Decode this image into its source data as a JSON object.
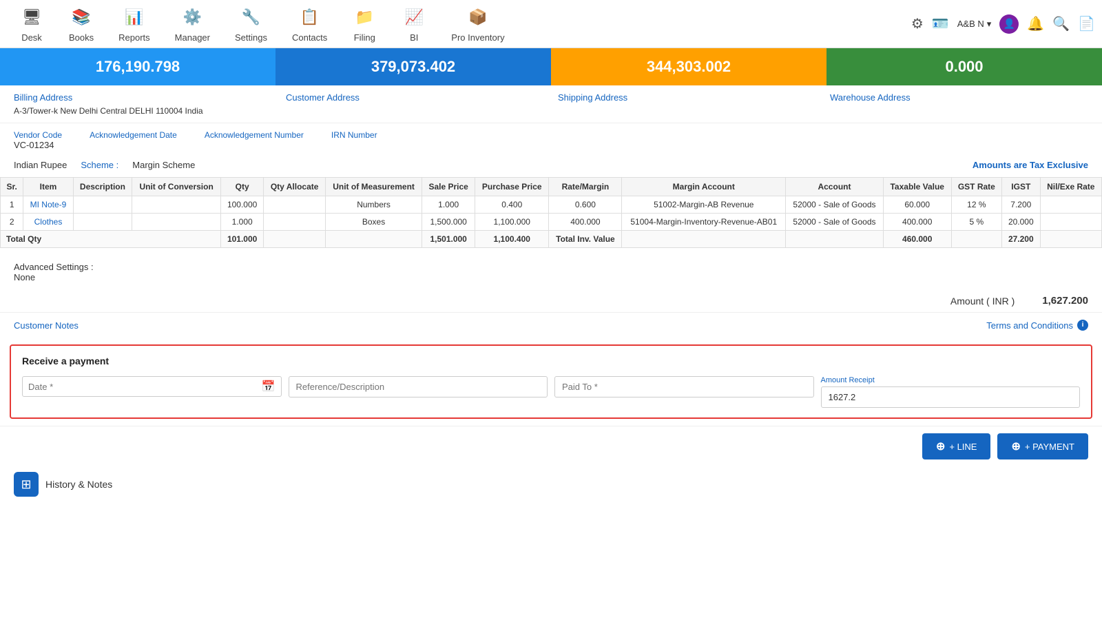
{
  "nav": {
    "items": [
      {
        "id": "desk",
        "label": "Desk",
        "icon": "🖥"
      },
      {
        "id": "books",
        "label": "Books",
        "icon": "📚"
      },
      {
        "id": "reports",
        "label": "Reports",
        "icon": "📊"
      },
      {
        "id": "manager",
        "label": "Manager",
        "icon": "⚙️"
      },
      {
        "id": "settings",
        "label": "Settings",
        "icon": "🔧"
      },
      {
        "id": "contacts",
        "label": "Contacts",
        "icon": "📋"
      },
      {
        "id": "filing",
        "label": "Filing",
        "icon": "📁"
      },
      {
        "id": "bi",
        "label": "BI",
        "icon": "📈"
      },
      {
        "id": "pro-inventory",
        "label": "Pro Inventory",
        "icon": "📦"
      }
    ],
    "user": "A&B N",
    "right_icons": [
      "⚙",
      "🪪",
      "🔔",
      "🔍",
      "📄"
    ]
  },
  "summary_cards": [
    {
      "value": "176,190.798",
      "color": "card-blue"
    },
    {
      "value": "379,073.402",
      "color": "card-blue2"
    },
    {
      "value": "344,303.002",
      "color": "card-orange"
    },
    {
      "value": "0.000",
      "color": "card-green"
    }
  ],
  "addresses": {
    "billing": {
      "label": "Billing Address",
      "text": "A-3/Tower-k New Delhi Central DELHI 110004 India"
    },
    "customer": {
      "label": "Customer Address",
      "text": ""
    },
    "shipping": {
      "label": "Shipping Address",
      "text": ""
    },
    "warehouse": {
      "label": "Warehouse Address",
      "text": ""
    }
  },
  "vendor": {
    "code_label": "Vendor Code",
    "code_value": "VC-01234",
    "ack_date_label": "Acknowledgement Date",
    "ack_date_value": "",
    "ack_number_label": "Acknowledgement Number",
    "ack_number_value": "",
    "irn_label": "IRN Number",
    "irn_value": ""
  },
  "scheme": {
    "label": "Scheme :",
    "value": "Margin Scheme",
    "currency": "Indian Rupee",
    "tax_exclusive": "Amounts are Tax Exclusive"
  },
  "table": {
    "headers": [
      "Sr.",
      "Item",
      "Description",
      "Unit of Conversion",
      "Qty",
      "Qty Allocate",
      "Unit of Measurement",
      "Sale Price",
      "Purchase Price",
      "Rate/Margin",
      "Margin Account",
      "Account",
      "Taxable Value",
      "GST Rate",
      "IGST",
      "Nil/Exe Rate"
    ],
    "rows": [
      {
        "sr": "1",
        "item": "MI Note-9",
        "description": "",
        "unit_conversion": "",
        "qty": "100.000",
        "qty_allocate": "",
        "uom": "Numbers",
        "sale_price": "1.000",
        "purchase_price": "0.400",
        "rate_margin": "0.600",
        "margin_account": "51002-Margin-AB Revenue",
        "account": "52000 - Sale of Goods",
        "taxable_value": "60.000",
        "gst_rate": "12 %",
        "igst": "7.200",
        "nil_exe_rate": ""
      },
      {
        "sr": "2",
        "item": "Clothes",
        "description": "",
        "unit_conversion": "",
        "qty": "1.000",
        "qty_allocate": "",
        "uom": "Boxes",
        "sale_price": "1,500.000",
        "purchase_price": "1,100.000",
        "rate_margin": "400.000",
        "margin_account": "51004-Margin-Inventory-Revenue-AB01",
        "account": "52000 - Sale of Goods",
        "taxable_value": "400.000",
        "gst_rate": "5 %",
        "igst": "20.000",
        "nil_exe_rate": ""
      }
    ],
    "total_row": {
      "label": "Total Qty",
      "qty": "101.000",
      "sale_price": "1,501.000",
      "purchase_price": "1,100.400",
      "total_inv_label": "Total Inv. Value",
      "taxable_value": "460.000",
      "igst": "27.200"
    }
  },
  "advanced_settings": {
    "label": "Advanced Settings :",
    "value": "None"
  },
  "amount": {
    "label": "Amount ( INR )",
    "value": "1,627.200"
  },
  "links": {
    "customer_notes": "Customer Notes",
    "terms_conditions": "Terms and Conditions"
  },
  "receive_payment": {
    "title": "Receive a payment",
    "date_placeholder": "Date *",
    "reference_placeholder": "Reference/Description",
    "paid_to_placeholder": "Paid To *",
    "amount_receipt_label": "Amount Receipt",
    "amount_receipt_value": "1627.2"
  },
  "bottom_buttons": {
    "line_label": "+ LINE",
    "payment_label": "+ PAYMENT"
  },
  "history": {
    "label": "History & Notes"
  }
}
